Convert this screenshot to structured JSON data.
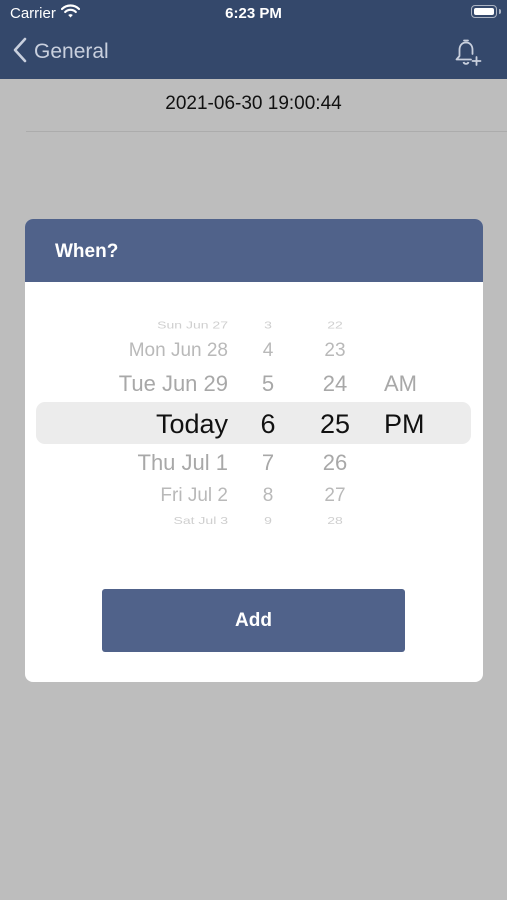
{
  "status_bar": {
    "carrier": "Carrier",
    "time": "6:23 PM"
  },
  "nav": {
    "back_label": "General",
    "icons": [
      "chevron-left-icon",
      "bell-plus-icon"
    ]
  },
  "current_date": "2021-06-30 19:00:44",
  "dialog": {
    "title": "When?",
    "picker": {
      "days": [
        "Sun Jun 27",
        "Mon Jun 28",
        "Tue Jun 29",
        "Today",
        "Thu Jul 1",
        "Fri Jul 2",
        "Sat Jul 3"
      ],
      "hours": [
        "3",
        "4",
        "5",
        "6",
        "7",
        "8",
        "9"
      ],
      "minutes": [
        "22",
        "23",
        "24",
        "25",
        "26",
        "27",
        "28"
      ],
      "periods": [
        "AM",
        "PM"
      ],
      "selected": {
        "day": "Today",
        "hour": "6",
        "minute": "25",
        "period": "PM"
      }
    },
    "add_label": "Add"
  },
  "colors": {
    "nav_bar": "#34486b",
    "dialog_header": "#50628a",
    "button": "#50628a",
    "backdrop": "#bdbdbd"
  }
}
